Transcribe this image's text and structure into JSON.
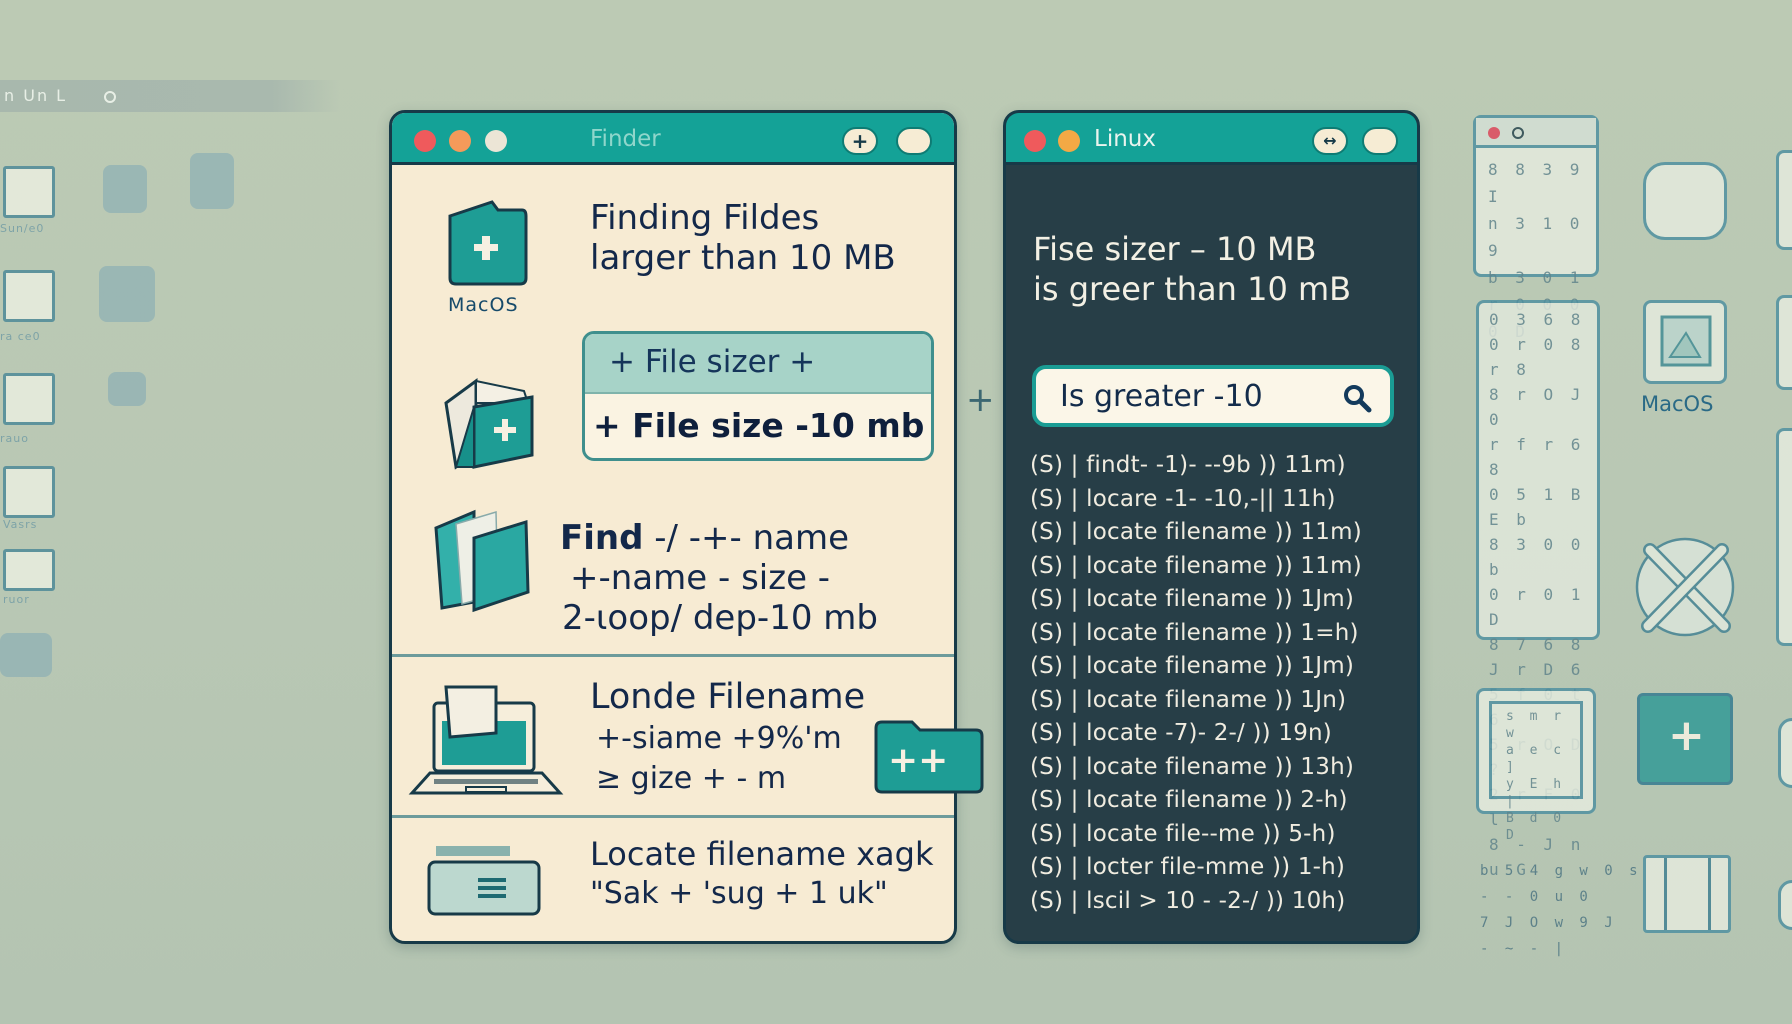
{
  "background": {
    "top_bar_text": "n Un L",
    "left_tile_labels": [
      "Sun/e0",
      "ra ce0",
      "rauo",
      "Vasrs",
      "ruor"
    ],
    "right_macos_label": "MacOS",
    "right_panel_glyphs": [
      [
        "8 8 3 9 I",
        "n 3 1 0  9",
        "b 3 0 1",
        "r 0 0 0 0 D"
      ],
      [
        "0 3 6 8",
        "0 r 0 8 r 8",
        "8 r O J 0",
        "r f r 6 8",
        "0 5 1 B E b",
        "8 3 0 0 b",
        "0 r 0 1 D",
        "8 7 6 8",
        "J r D 6",
        "5 f 0 t 6",
        "5 r O D ?",
        "2 r F 0 l",
        "8 - J n u G"
      ],
      [
        "s m r w",
        "a e c ]",
        "y E h |",
        "B d 0 D"
      ],
      [
        "b 5 4 g w 0 s",
        "- - 0 u  0",
        "7 J O w 9 J",
        "- ~ - |"
      ]
    ],
    "mid_plus": "+"
  },
  "finder": {
    "title": "Finder",
    "colors": {
      "titlebar": "#14a297",
      "body": "#f7ebd3",
      "accent": "#1a9c94"
    },
    "titlebar_buttons": [
      "+",
      ""
    ],
    "header": {
      "icon_label": "MacOS",
      "title_line1": "Finding Fildes",
      "title_line2": "larger than 10 MB"
    },
    "search_card": {
      "top_label": "+  File sizer +",
      "bottom_value": "+ File size -10 mb"
    },
    "find_section": {
      "line1_bold": "Find",
      "line1_rest": " -/ -+- name",
      "line2": "+-name - size -",
      "line3": "2-ιoop/ dep-10 mb"
    },
    "locate_section": {
      "title": "Londe Filename",
      "line2": "+-siame +9%'m",
      "line3": "≥ gize + - m",
      "folder_badge": "++"
    },
    "last_section": {
      "title": "Locate filename xagk",
      "line2": "\"Sak + 'sug + 1 uk\""
    }
  },
  "linux": {
    "title": "Linux",
    "colors": {
      "titlebar": "#14a297",
      "body": "#273e47"
    },
    "titlebar_buttons": [
      "↔",
      ""
    ],
    "heading_line1": "Fise sizer – 10 MB",
    "heading_line2": "is greer than 10 mB",
    "search": {
      "value": "Is greater -10",
      "icon": "search-icon"
    },
    "terminal_lines": [
      "(S) | findt-  -1)- --9b )) 11m)",
      "(S) | locare -1- -10,-|| 11h)",
      "(S) | locate filename )) 11m)",
      "(S) | locate filename )) 11m)",
      "(S) | locate filename )) 1Jm)",
      "(S) | locate filename )) 1=h)",
      "(S) | locate filename )) 1Jm)",
      "(S) | locate filename )) 1Jn)",
      "(S) | locate -7)- 2-/ )) 19n)",
      "(S) | locate filename )) 13h)",
      "(S) | locate filename )) 2-h)",
      "(S) | locate file--me )) 5-h)",
      "(S) | locter file-mme )) 1-h)",
      "(S) | lscil > 10 - -2-/ )) 10h)"
    ]
  }
}
